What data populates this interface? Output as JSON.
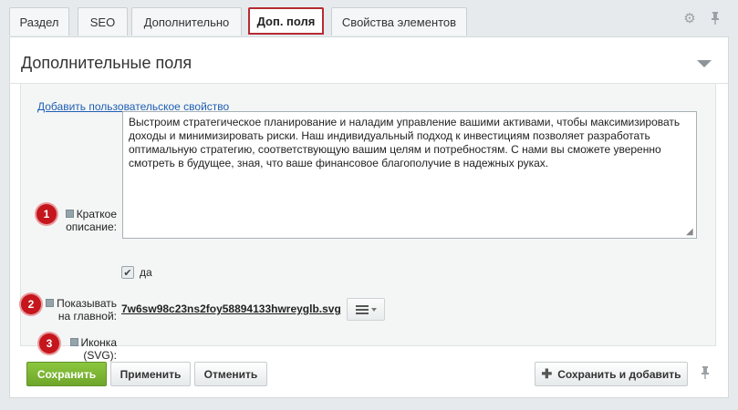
{
  "tabs": [
    {
      "label": "Раздел",
      "active": false
    },
    {
      "label": "SEO",
      "active": false
    },
    {
      "label": "Дополнительно",
      "active": false
    },
    {
      "label": "Доп. поля",
      "active": true
    },
    {
      "label": "Свойства элементов",
      "active": false
    }
  ],
  "section": {
    "title": "Дополнительные поля",
    "add_property_link": "Добавить пользовательское свойство"
  },
  "fields": {
    "description": {
      "badge": "1",
      "label_line1": "Краткое",
      "label_line2": "описание:",
      "value": "Выстроим стратегическое планирование и наладим управление вашими активами, чтобы максимизировать доходы и минимизировать риски. Наш индивидуальный подход к инвестициям позволяет разработать оптимальную стратегию, соответствующую вашим целям и потребностям. С нами вы сможете уверенно смотреть в будущее, зная, что ваше финансовое благополучие в надежных руках."
    },
    "show_on_main": {
      "badge": "2",
      "label_line1": "Показывать",
      "label_line2": "на главной:",
      "checked": true,
      "checkbox_text": "да"
    },
    "icon": {
      "badge": "3",
      "label_line1": "Иконка",
      "label_line2": "(SVG):",
      "file_name": "7w6sw98c23ns2foy58894133hwreyglb.svg"
    }
  },
  "footer": {
    "save_label": "Сохранить",
    "apply_label": "Применить",
    "cancel_label": "Отменить",
    "save_add_label": "Сохранить и добавить"
  },
  "colors": {
    "accent_tab_border": "#b52b32",
    "badge": "#c4161c",
    "save_button": "#7ab434",
    "link": "#1f5eb3"
  },
  "icons": [
    "gear-icon",
    "pin-icon",
    "collapse-arrow-icon",
    "help-icon",
    "menu-icon",
    "plus-icon"
  ]
}
